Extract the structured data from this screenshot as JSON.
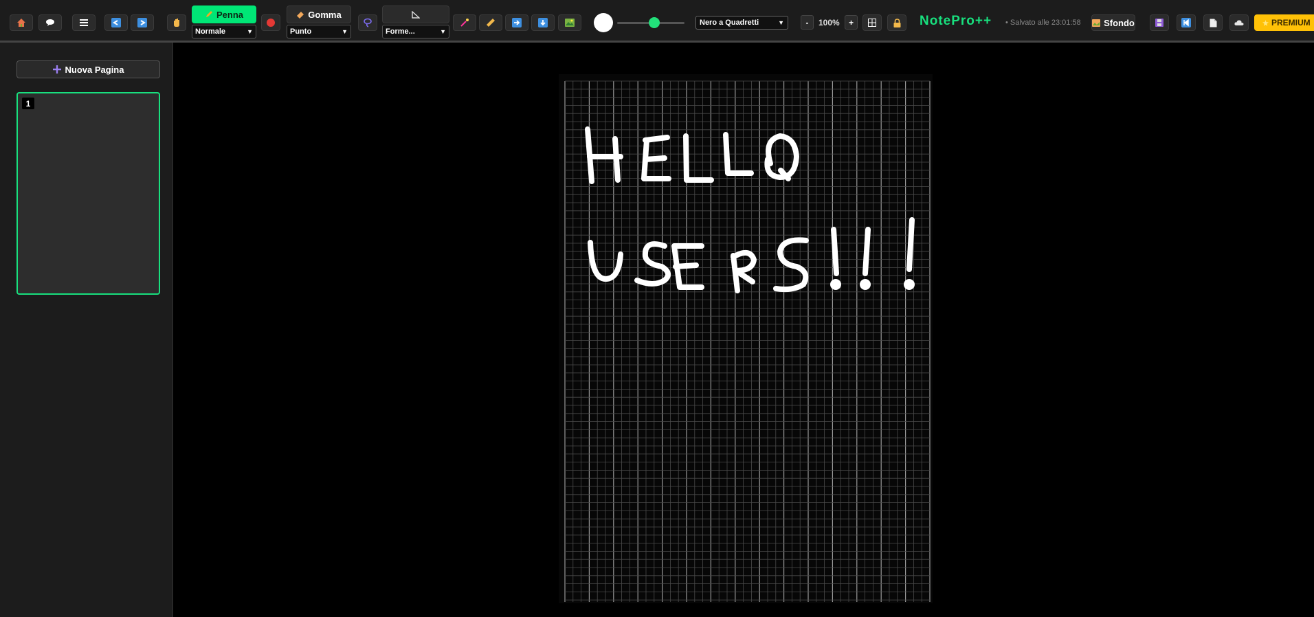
{
  "toolbar": {
    "pen": {
      "label": "Penna",
      "mode": "Normale"
    },
    "eraser": {
      "label": "Gomma",
      "mode": "Punto"
    },
    "shapes": {
      "mode": "Forme..."
    },
    "background_select": "Nero a Quadretti",
    "zoom": {
      "minus": "-",
      "level": "100%",
      "plus": "+"
    },
    "app_title": "NotePro++",
    "save_status": "• Salvato alle 23:01:58",
    "sfondo_label": "Sfondo",
    "premium_label": "PREMIUM",
    "stroke_size_fraction": 0.55
  },
  "sidebar": {
    "new_page_label": "Nuova Pagina",
    "pages": [
      {
        "number": "1"
      }
    ]
  },
  "canvas": {
    "background": "black grid",
    "ink_color": "#ffffff",
    "handwritten_text": [
      "HELLO",
      "USERS!!!"
    ]
  },
  "colors": {
    "accent": "#18e07e",
    "pen_active": "#00e676",
    "premium": "#ffc107",
    "ink_dot": "#e53935"
  }
}
